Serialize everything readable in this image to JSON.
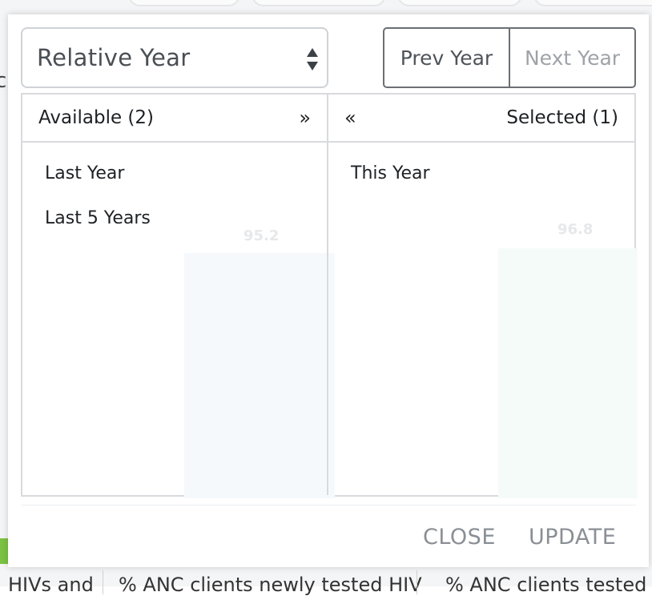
{
  "period_type": {
    "selected": "Relative Year"
  },
  "year_nav": {
    "prev": "Prev Year",
    "next": "Next Year"
  },
  "available": {
    "header": "Available (2)",
    "select_all": "»",
    "items": [
      "Last Year",
      "Last 5 Years"
    ]
  },
  "selected": {
    "header": "Selected (1)",
    "deselect_all": "«",
    "items": [
      "This Year"
    ]
  },
  "background_chart": {
    "values": [
      "95.2",
      "96.8"
    ]
  },
  "background_text": {
    "left_fragment": "c",
    "col1": "HIVs and",
    "col2": "% ANC clients newly tested HIV",
    "col3": "% ANC clients tested f"
  },
  "footer": {
    "close": "CLOSE",
    "update": "UPDATE"
  },
  "colors": {
    "primary_text": "#1e2124",
    "muted_text": "#8a8f95",
    "border": "#d8dadd",
    "accent_green": "#7cc242"
  }
}
